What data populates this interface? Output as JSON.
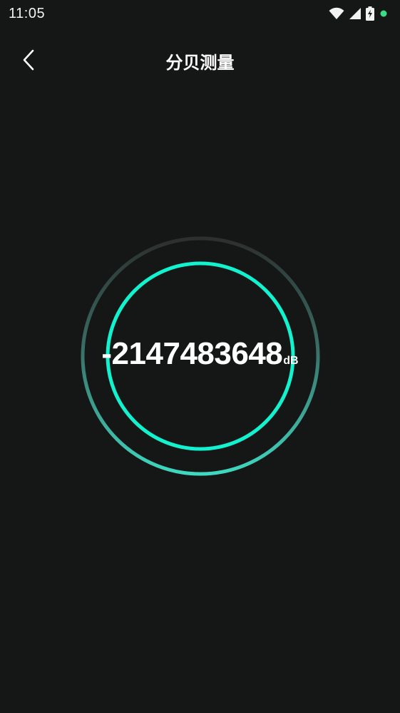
{
  "status_bar": {
    "time": "11:05",
    "icons": [
      "wifi-icon",
      "cellular-signal-icon",
      "battery-charging-icon",
      "notification-dot-icon"
    ],
    "dot_color": "#3ddc84"
  },
  "app_bar": {
    "back_icon": "chevron-left-icon",
    "title": "分贝测量"
  },
  "meter": {
    "value": "-2147483648",
    "unit": "dB",
    "inner_ring_color": "#12f2cf",
    "outer_ring_gradient": [
      "#2c2f2e",
      "#3fd8c0"
    ]
  },
  "colors": {
    "background": "#151716",
    "text": "#ffffff"
  }
}
